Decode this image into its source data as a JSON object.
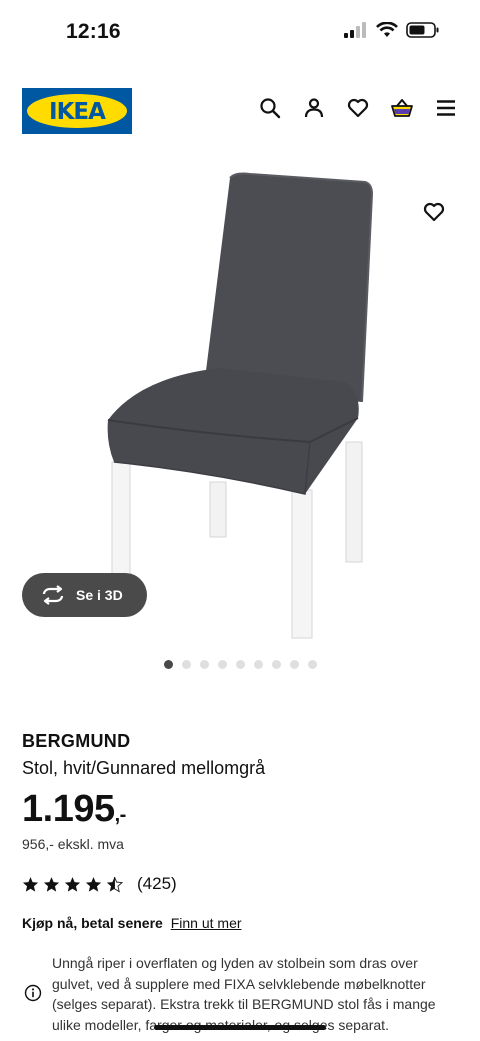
{
  "status_bar": {
    "time": "12:16"
  },
  "header": {
    "logo_text": "IKEA",
    "icons": [
      "search-icon",
      "user-icon",
      "heart-icon",
      "basket-icon",
      "menu-icon"
    ]
  },
  "gallery": {
    "view_3d_label": "Se i 3D",
    "dots_total": 9,
    "active_dot": 0
  },
  "product": {
    "name": "BERGMUND",
    "description": "Stol, hvit/Gunnared mellomgrå",
    "price": "1.195",
    "price_suffix": ",-",
    "price_ex_vat": "956,- ekskl. mva",
    "rating_value": 4.5,
    "rating_count": "(425)"
  },
  "financing": {
    "label": "Kjøp nå, betal senere",
    "link": "Finn ut mer"
  },
  "notice": {
    "text": "Unngå riper i overflaten og lyden av stolbein som dras over gulvet, ved å supplere med FIXA selvklebende møbelknotter (selges separat). Ekstra trekk til BERGMUND stol fås i mange ulike modeller, farger og materialer, og selges separat."
  },
  "colors": {
    "ikea_blue": "#0058A3",
    "ikea_yellow": "#FFDB00",
    "chair_fabric": "#4b4c52",
    "button_dark": "#4a4a4a"
  }
}
